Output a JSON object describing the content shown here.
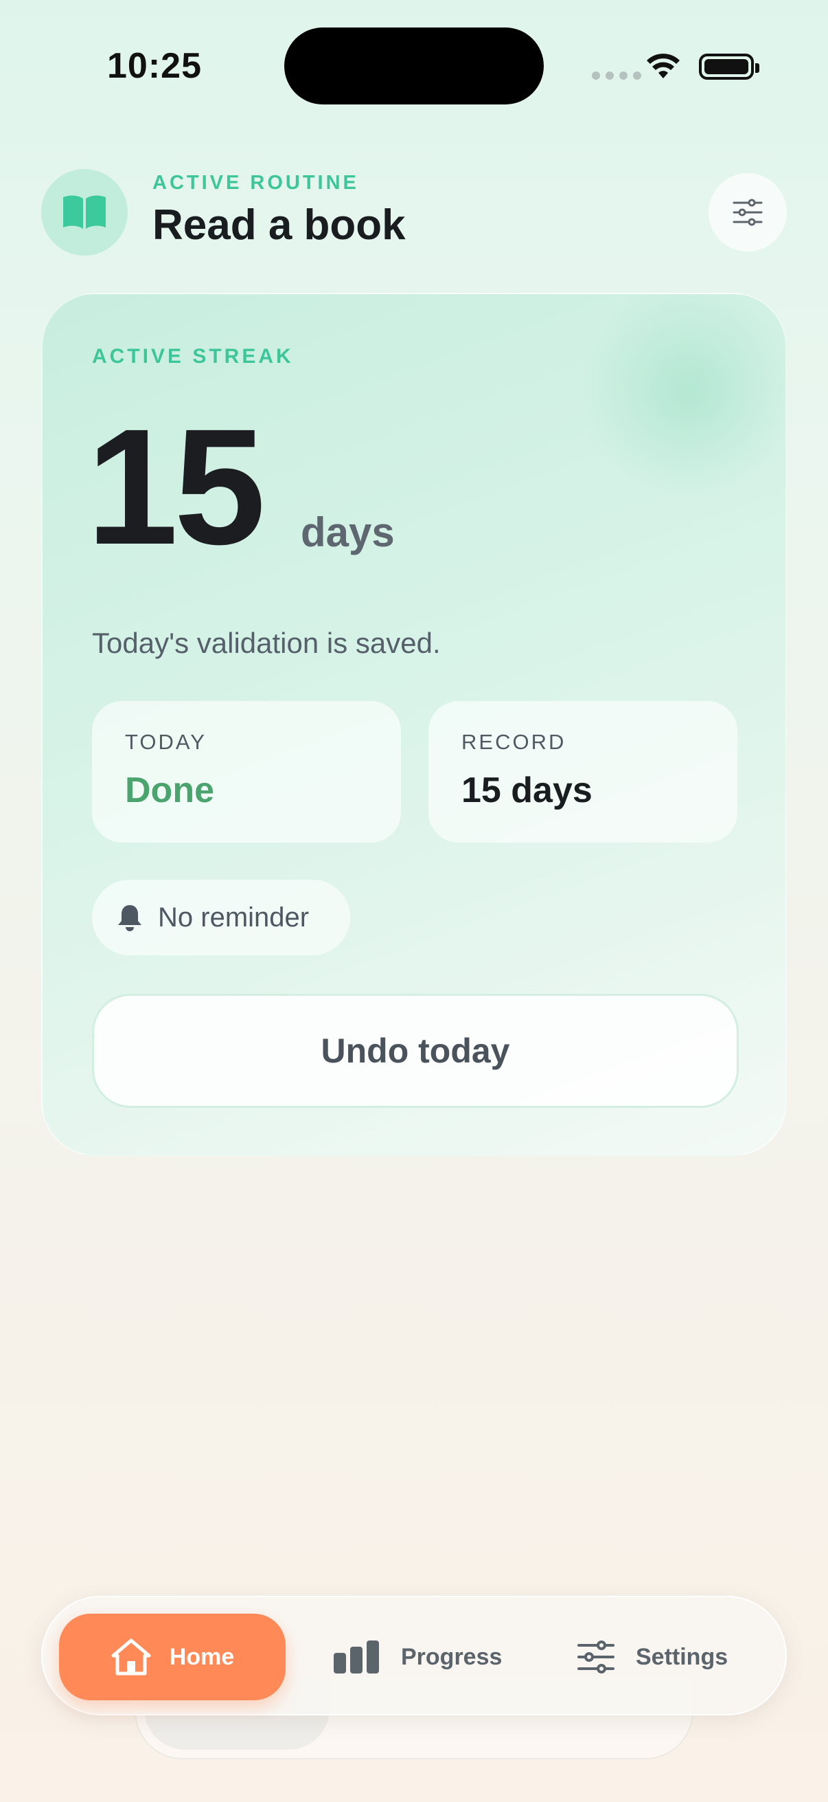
{
  "status_bar": {
    "time": "10:25",
    "icons": [
      "cellular-signal-icon",
      "wifi-icon",
      "battery-icon"
    ]
  },
  "header": {
    "routine_icon": "open-book-icon",
    "eyebrow": "ACTIVE ROUTINE",
    "title": "Read a book",
    "settings_icon": "sliders-icon"
  },
  "streak_card": {
    "label": "ACTIVE STREAK",
    "count": "15",
    "unit": "days",
    "validation_text": "Today's validation is saved.",
    "today": {
      "label": "TODAY",
      "value": "Done"
    },
    "record": {
      "label": "RECORD",
      "value": "15 days"
    },
    "reminder": {
      "icon": "bell-icon",
      "text": "No reminder"
    },
    "undo_label": "Undo today"
  },
  "tab_bar": {
    "active": "Home",
    "items": [
      {
        "label": "Home",
        "icon": "home-icon"
      },
      {
        "label": "Progress",
        "icon": "bar-chart-icon"
      },
      {
        "label": "Settings",
        "icon": "sliders-icon"
      }
    ]
  },
  "colors": {
    "accent_green": "#3fc59a",
    "done_green": "#4ba36e",
    "active_tab": "#ff8a57"
  }
}
